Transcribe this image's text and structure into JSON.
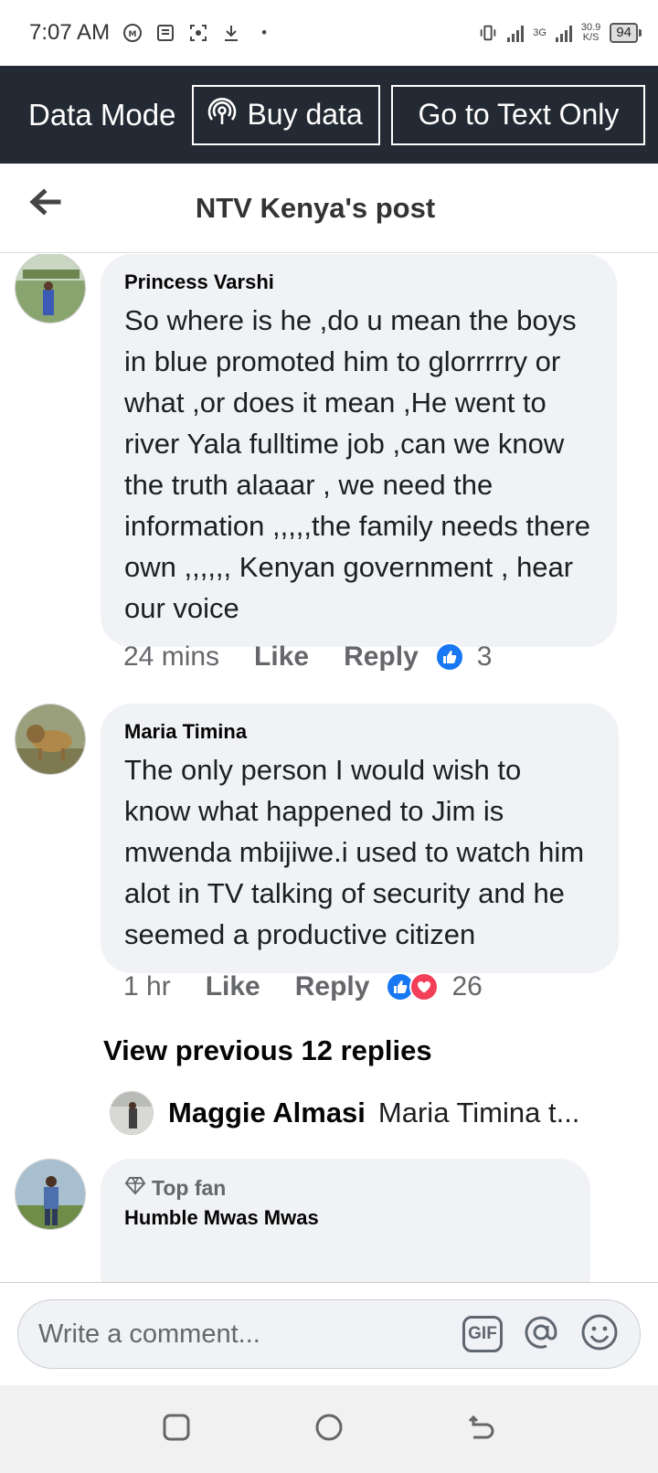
{
  "status_bar": {
    "time": "7:07 AM",
    "network": "3G",
    "speed_value": "30.9",
    "speed_unit": "K/S",
    "battery": "94"
  },
  "data_bar": {
    "label": "Data Mode",
    "buy_label": "Buy data",
    "text_only_label": "Go to Text Only"
  },
  "header": {
    "title": "NTV Kenya's post"
  },
  "comments": [
    {
      "author": "Princess Varshi",
      "text": "So where is he ,do u mean the boys in blue promoted him to glorrrrry or what ,or does it mean ,He went to river Yala fulltime job ,can we know the truth alaaar , we need the information ,,,,,the family needs there own ,,,,,, Kenyan government , hear our voice",
      "time": "24 mins",
      "like_label": "Like",
      "reply_label": "Reply",
      "reaction_count": "3"
    },
    {
      "author": "Maria Timina",
      "text": "The only person I would wish to know what happened to Jim is mwenda mbijiwe.i used to watch him alot in TV talking of security and he seemed a productive citizen",
      "time": "1 hr",
      "like_label": "Like",
      "reply_label": "Reply",
      "reaction_count": "26",
      "view_previous": "View previous 12 replies",
      "latest_reply": {
        "author": "Maggie Almasi",
        "text": "Maria Timina t..."
      }
    },
    {
      "badge": "Top fan",
      "author": "Humble Mwas Mwas"
    }
  ],
  "composer": {
    "placeholder": "Write a comment...",
    "gif_label": "GIF"
  },
  "colors": {
    "data_bar_bg": "#242a33",
    "bubble_bg": "#f0f2f5",
    "like_blue": "#1877f2",
    "love_red": "#f33e58"
  }
}
